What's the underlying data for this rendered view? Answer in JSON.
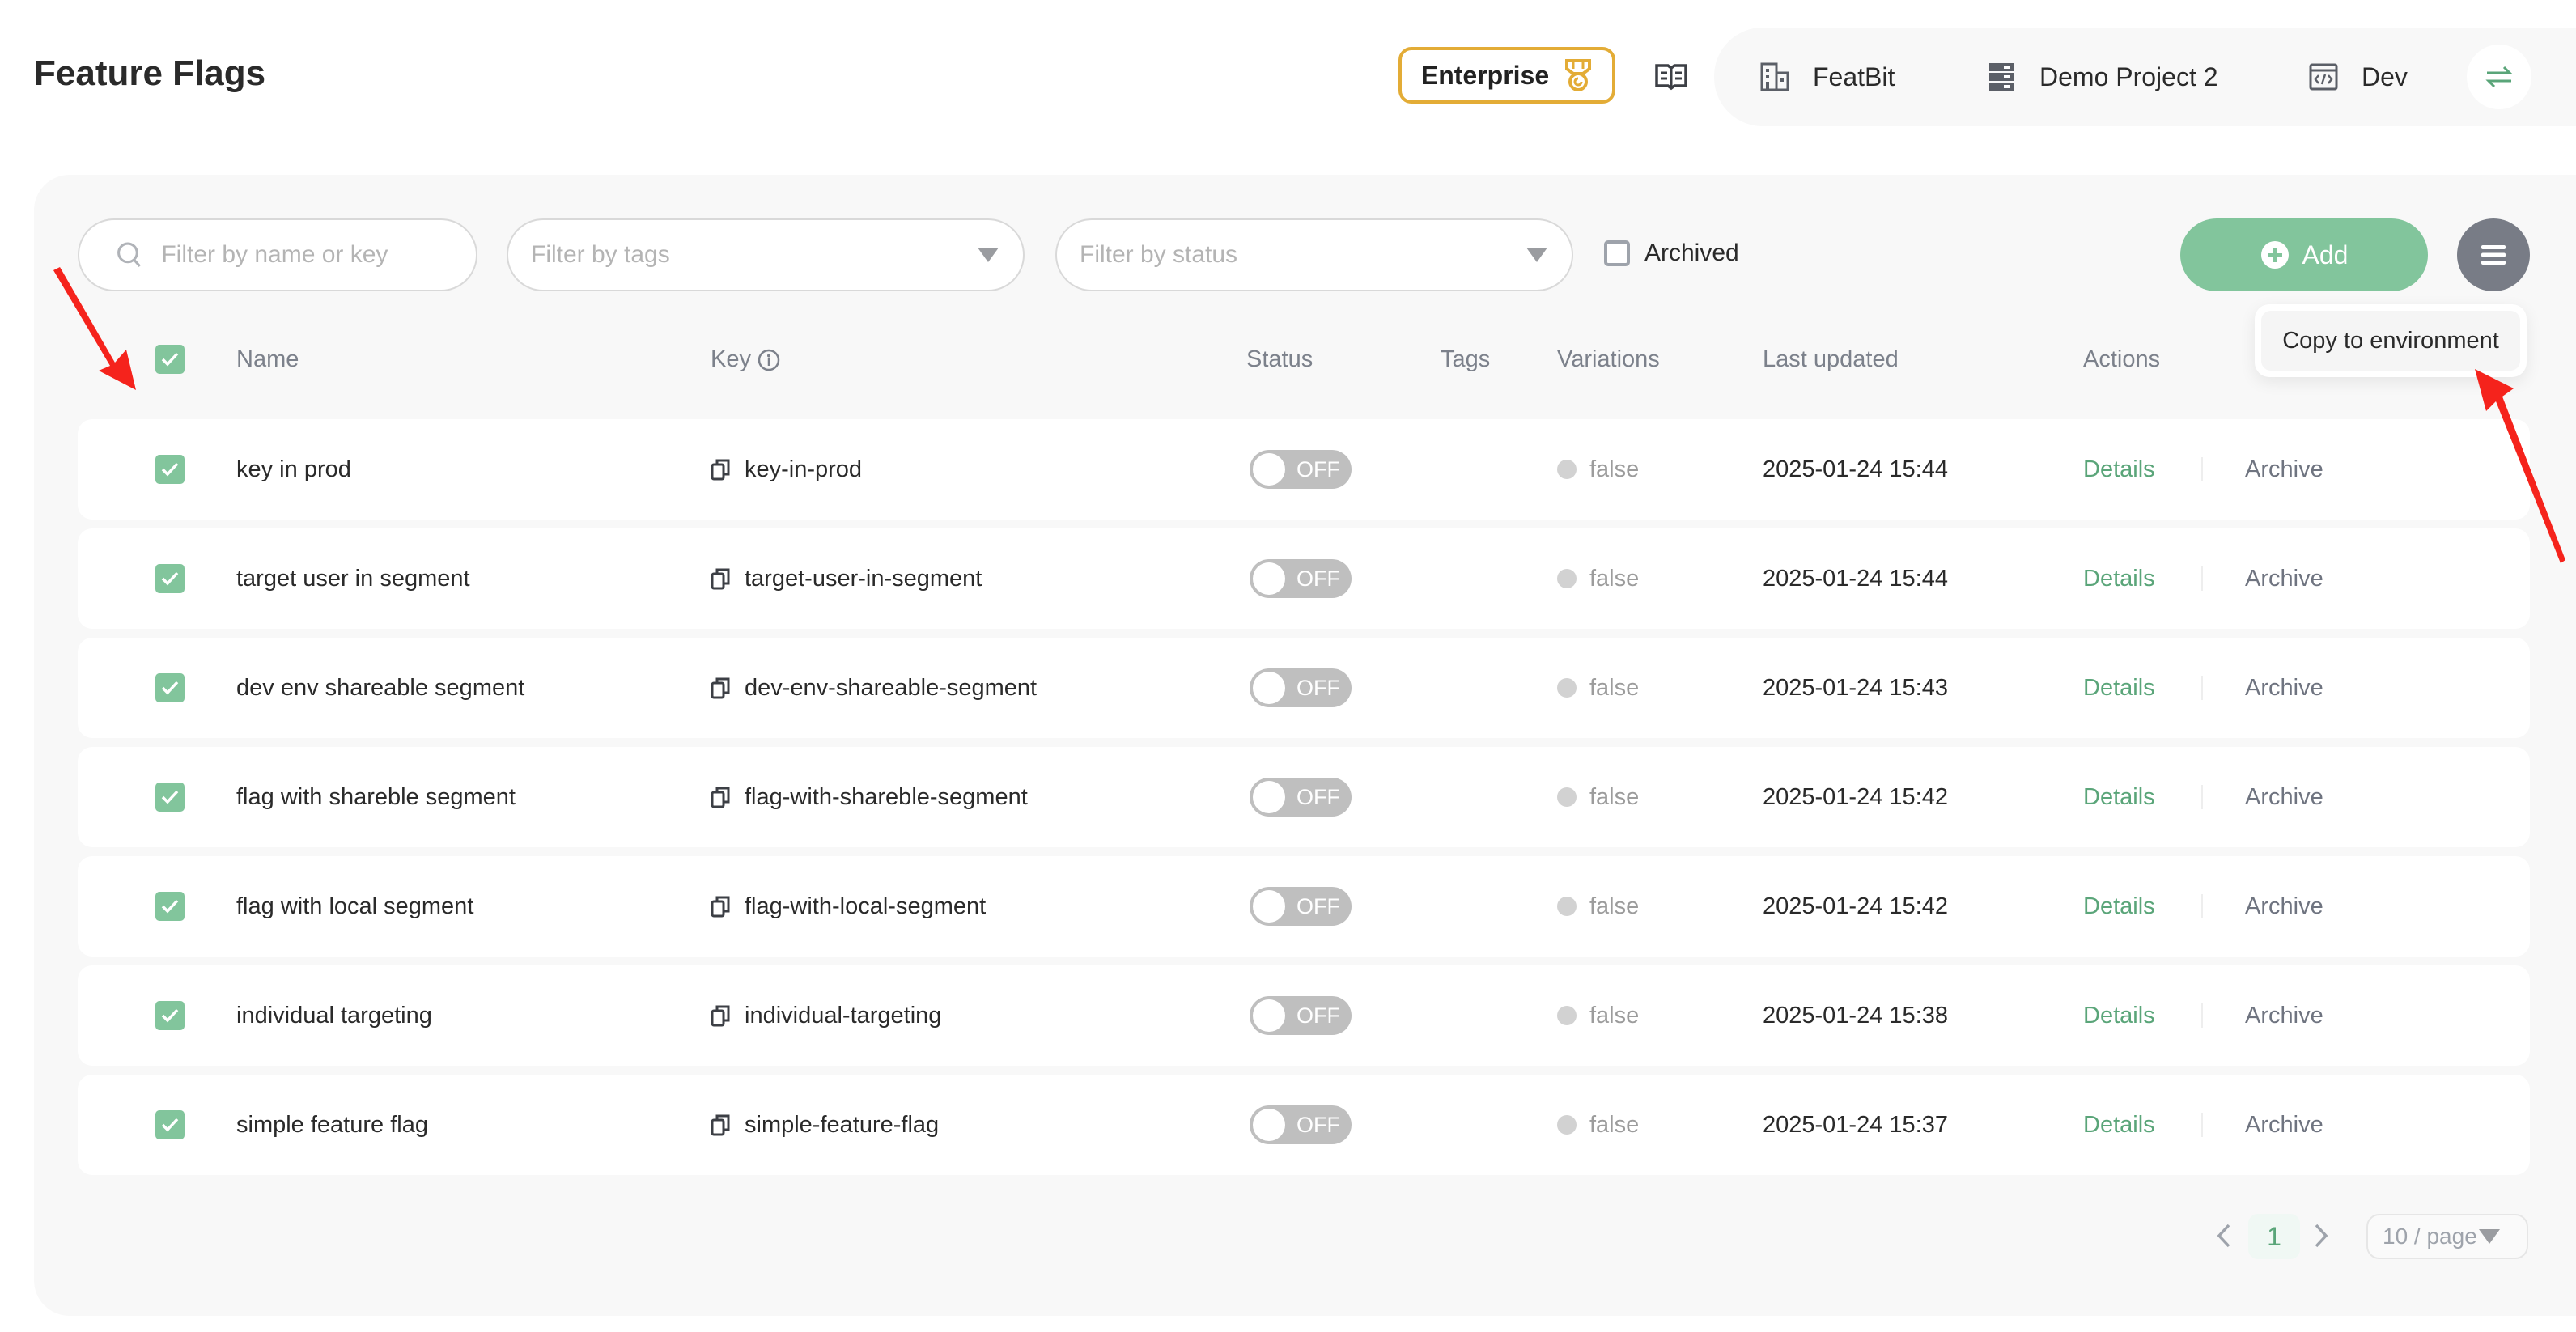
{
  "header": {
    "title": "Feature Flags",
    "plan_badge": "Enterprise",
    "organization": "FeatBit",
    "project": "Demo Project 2",
    "environment": "Dev"
  },
  "toolbar": {
    "search_placeholder": "Filter by name or key",
    "tags_placeholder": "Filter by tags",
    "status_placeholder": "Filter by status",
    "archived_label": "Archived",
    "archived_checked": false,
    "add_label": "Add",
    "menu_items": [
      "Copy to environment"
    ]
  },
  "table": {
    "columns": [
      "Name",
      "Key",
      "Status",
      "Tags",
      "Variations",
      "Last updated",
      "Actions"
    ],
    "all_selected": true,
    "rows": [
      {
        "name": "key in prod",
        "key": "key-in-prod",
        "status": "OFF",
        "tags": "",
        "variation": "false",
        "updated": "2025-01-24 15:44",
        "selected": true
      },
      {
        "name": "target user in segment",
        "key": "target-user-in-segment",
        "status": "OFF",
        "tags": "",
        "variation": "false",
        "updated": "2025-01-24 15:44",
        "selected": true
      },
      {
        "name": "dev env shareable segment",
        "key": "dev-env-shareable-segment",
        "status": "OFF",
        "tags": "",
        "variation": "false",
        "updated": "2025-01-24 15:43",
        "selected": true
      },
      {
        "name": "flag with shareble segment",
        "key": "flag-with-shareble-segment",
        "status": "OFF",
        "tags": "",
        "variation": "false",
        "updated": "2025-01-24 15:42",
        "selected": true
      },
      {
        "name": "flag with local segment",
        "key": "flag-with-local-segment",
        "status": "OFF",
        "tags": "",
        "variation": "false",
        "updated": "2025-01-24 15:42",
        "selected": true
      },
      {
        "name": "individual targeting",
        "key": "individual-targeting",
        "status": "OFF",
        "tags": "",
        "variation": "false",
        "updated": "2025-01-24 15:38",
        "selected": true
      },
      {
        "name": "simple feature flag",
        "key": "simple-feature-flag",
        "status": "OFF",
        "tags": "",
        "variation": "false",
        "updated": "2025-01-24 15:37",
        "selected": true
      }
    ],
    "actions": {
      "details": "Details",
      "archive": "Archive"
    }
  },
  "pagination": {
    "current_page": "1",
    "page_size": "10 / page"
  },
  "colors": {
    "accent_green": "#82c59c",
    "link_green": "#5aa579",
    "enterprise_gold": "#e3ac36",
    "annotation_red": "#f5231c"
  }
}
